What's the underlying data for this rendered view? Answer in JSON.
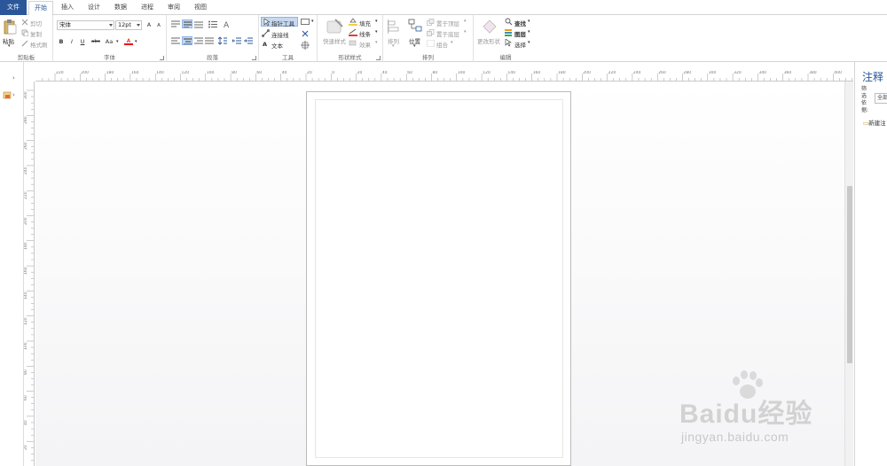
{
  "tabs": [
    {
      "label": "文件"
    },
    {
      "label": "开始"
    },
    {
      "label": "插入"
    },
    {
      "label": "设计"
    },
    {
      "label": "数据"
    },
    {
      "label": "进程"
    },
    {
      "label": "审阅"
    },
    {
      "label": "视图"
    }
  ],
  "clipboard": {
    "paste": "粘贴",
    "cut": "剪切",
    "copy": "复制",
    "format_painter": "格式刷",
    "label": "剪贴板"
  },
  "font": {
    "family": "宋体",
    "size": "12pt",
    "bold": "B",
    "italic": "I",
    "underline": "U",
    "strike": "abc",
    "case": "Aa",
    "color": "A",
    "grow": "A",
    "shrink": "A",
    "label": "字体"
  },
  "paragraph": {
    "label": "段落"
  },
  "tools": {
    "pointer": "指针工具",
    "connector": "连接线",
    "text": "文本",
    "label": "工具"
  },
  "shape_styles": {
    "quick_styles": "快速样式",
    "fill": "填充",
    "line": "线条",
    "effects": "效果",
    "label": "形状样式"
  },
  "arrange": {
    "align": "排列",
    "position": "位置",
    "bring_front": "置于顶层",
    "send_back": "置于底层",
    "group": "组合",
    "label": "排列"
  },
  "editing": {
    "change_shape": "更改形状",
    "find": "查找",
    "layers": "图层",
    "select": "选择",
    "label": "编辑"
  },
  "ruler_h": [
    "220",
    "200",
    "180",
    "160",
    "140",
    "120",
    "100",
    "80",
    "60",
    "40",
    "20",
    "0",
    "20",
    "40",
    "60",
    "80",
    "100",
    "120",
    "140",
    "160",
    "180",
    "200",
    "220",
    "240",
    "260",
    "280",
    "300",
    "320",
    "340",
    "360",
    "380",
    "400",
    "420"
  ],
  "ruler_v": [
    "300",
    "280",
    "260",
    "240",
    "220",
    "200",
    "180",
    "160",
    "140",
    "120",
    "100",
    "80",
    "60",
    "40",
    "20"
  ],
  "comments_pane": {
    "title": "注释",
    "filter_line1": "筛",
    "filter_line2": "选",
    "filter_line3": "依",
    "filter_line4": "据:",
    "filter_value": "全部",
    "new_comment": "新建注"
  },
  "watermark": {
    "brand": "Baidu经验",
    "url": "jingyan.baidu.com"
  },
  "colors": {
    "file_tab": "#2b579a",
    "accent": "#2b579a",
    "selected": "#c5d9f1"
  }
}
